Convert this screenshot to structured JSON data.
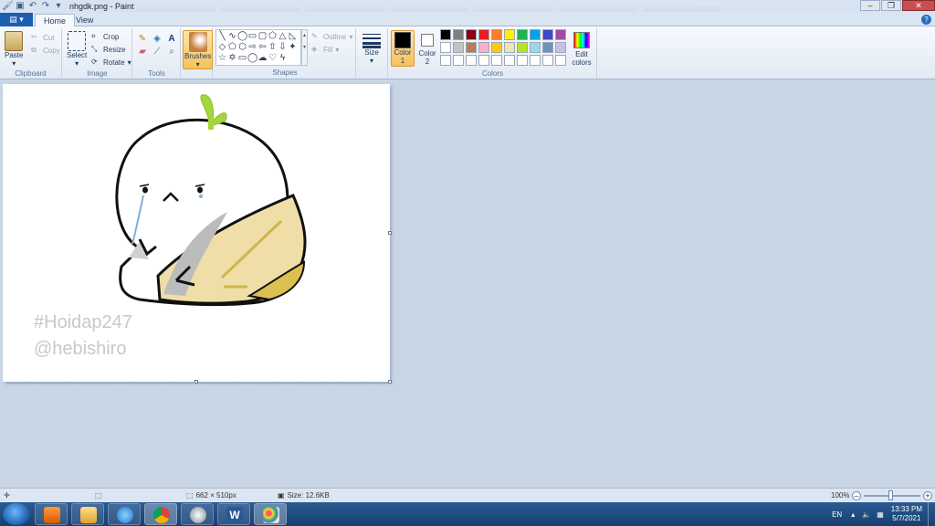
{
  "window": {
    "title": "nhgdk.png - Paint"
  },
  "ribbon": {
    "tabs": [
      {
        "label": "Home"
      },
      {
        "label": "View"
      }
    ],
    "clipboard": {
      "paste": "Paste",
      "cut": "Cut",
      "copy": "Copy",
      "label": "Clipboard"
    },
    "image": {
      "select": "Select",
      "crop": "Crop",
      "resize": "Resize",
      "rotate": "Rotate",
      "label": "Image"
    },
    "tools": {
      "label": "Tools"
    },
    "brushes": {
      "label": "Brushes"
    },
    "shapes": {
      "outline": "Outline",
      "fill": "Fill",
      "label": "Shapes"
    },
    "size": {
      "label": "Size"
    },
    "colors": {
      "color1": "Color 1",
      "color2": "Color 2",
      "edit": "Edit colors",
      "label": "Colors",
      "color1_value": "#000000",
      "color2_value": "#ffffff",
      "palette": [
        "#000000",
        "#7f7f7f",
        "#880015",
        "#ed1c24",
        "#ff7f27",
        "#fff200",
        "#22b14c",
        "#00a2e8",
        "#3f48cc",
        "#a349a4",
        "#ffffff",
        "#c3c3c3",
        "#b97a57",
        "#ffaec9",
        "#ffc90e",
        "#efe4b0",
        "#b5e61d",
        "#99d9ea",
        "#7092be",
        "#c8bfe7",
        "#ffffff",
        "#ffffff",
        "#ffffff",
        "#ffffff",
        "#ffffff",
        "#ffffff",
        "#ffffff",
        "#ffffff",
        "#ffffff",
        "#ffffff"
      ]
    }
  },
  "canvas": {
    "watermark1": "#Hoidap247",
    "watermark2": "@hebishiro"
  },
  "status": {
    "dimensions": "662 × 510px",
    "size": "Size: 12.6KB",
    "zoom": "100%"
  },
  "taskbar": {
    "lang": "EN",
    "time": "13:33 PM",
    "date": "5/7/2021"
  }
}
